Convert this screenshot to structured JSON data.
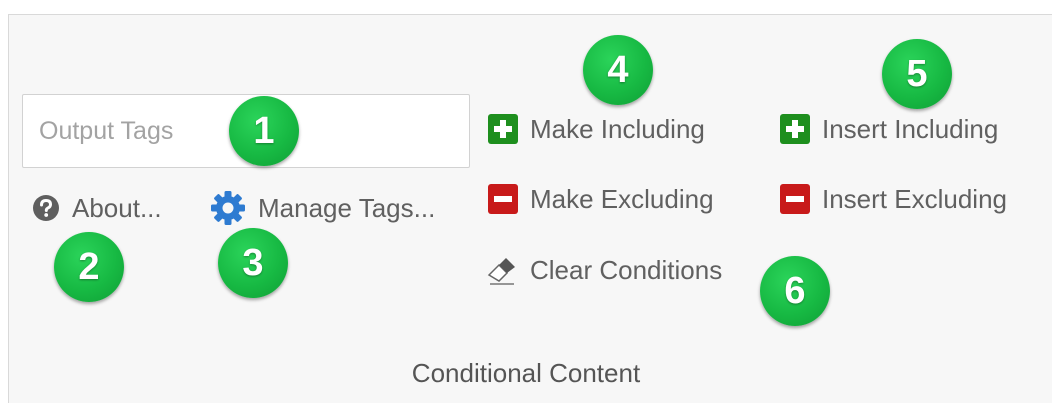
{
  "output_tags": {
    "placeholder": "Output Tags",
    "value": ""
  },
  "commands": {
    "about": {
      "label": "About...",
      "icon": "help-circle-icon"
    },
    "manage_tags": {
      "label": "Manage Tags...",
      "icon": "gear-icon"
    },
    "make_including": {
      "label": "Make Including",
      "icon": "plus-square-icon"
    },
    "make_excluding": {
      "label": "Make Excluding",
      "icon": "minus-square-icon"
    },
    "clear_conditions": {
      "label": "Clear Conditions",
      "icon": "eraser-icon"
    },
    "insert_including": {
      "label": "Insert Including",
      "icon": "plus-square-icon"
    },
    "insert_excluding": {
      "label": "Insert Excluding",
      "icon": "minus-square-icon"
    }
  },
  "callouts": {
    "output_tags": "1",
    "about": "2",
    "manage_tags": "3",
    "make_including": "4",
    "insert_including": "5",
    "clear_conditions": "6"
  },
  "group_label": "Conditional Content",
  "colors": {
    "panel_background": "#f7f7f7",
    "include_green": "#1e8f1e",
    "exclude_red": "#c81a1a",
    "gear_blue": "#2e7bd1",
    "callout_green": "#17b943"
  }
}
